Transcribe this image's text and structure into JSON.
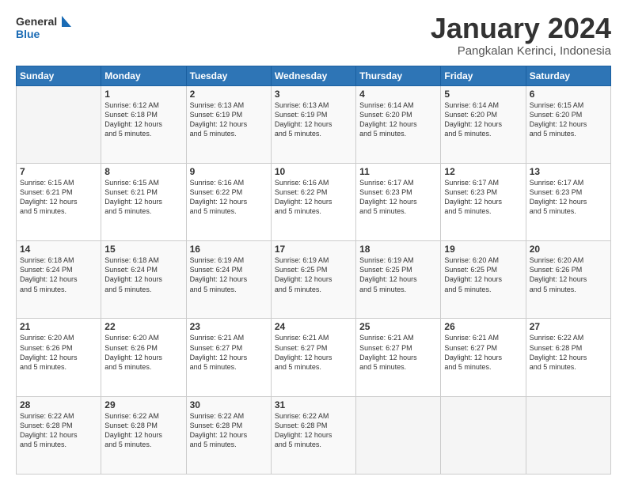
{
  "logo": {
    "line1": "General",
    "line2": "Blue"
  },
  "title": "January 2024",
  "subtitle": "Pangkalan Kerinci, Indonesia",
  "weekdays": [
    "Sunday",
    "Monday",
    "Tuesday",
    "Wednesday",
    "Thursday",
    "Friday",
    "Saturday"
  ],
  "weeks": [
    [
      {
        "day": "",
        "info": ""
      },
      {
        "day": "1",
        "info": "Sunrise: 6:12 AM\nSunset: 6:18 PM\nDaylight: 12 hours\nand 5 minutes."
      },
      {
        "day": "2",
        "info": "Sunrise: 6:13 AM\nSunset: 6:19 PM\nDaylight: 12 hours\nand 5 minutes."
      },
      {
        "day": "3",
        "info": "Sunrise: 6:13 AM\nSunset: 6:19 PM\nDaylight: 12 hours\nand 5 minutes."
      },
      {
        "day": "4",
        "info": "Sunrise: 6:14 AM\nSunset: 6:20 PM\nDaylight: 12 hours\nand 5 minutes."
      },
      {
        "day": "5",
        "info": "Sunrise: 6:14 AM\nSunset: 6:20 PM\nDaylight: 12 hours\nand 5 minutes."
      },
      {
        "day": "6",
        "info": "Sunrise: 6:15 AM\nSunset: 6:20 PM\nDaylight: 12 hours\nand 5 minutes."
      }
    ],
    [
      {
        "day": "7",
        "info": "Sunrise: 6:15 AM\nSunset: 6:21 PM\nDaylight: 12 hours\nand 5 minutes."
      },
      {
        "day": "8",
        "info": "Sunrise: 6:15 AM\nSunset: 6:21 PM\nDaylight: 12 hours\nand 5 minutes."
      },
      {
        "day": "9",
        "info": "Sunrise: 6:16 AM\nSunset: 6:22 PM\nDaylight: 12 hours\nand 5 minutes."
      },
      {
        "day": "10",
        "info": "Sunrise: 6:16 AM\nSunset: 6:22 PM\nDaylight: 12 hours\nand 5 minutes."
      },
      {
        "day": "11",
        "info": "Sunrise: 6:17 AM\nSunset: 6:23 PM\nDaylight: 12 hours\nand 5 minutes."
      },
      {
        "day": "12",
        "info": "Sunrise: 6:17 AM\nSunset: 6:23 PM\nDaylight: 12 hours\nand 5 minutes."
      },
      {
        "day": "13",
        "info": "Sunrise: 6:17 AM\nSunset: 6:23 PM\nDaylight: 12 hours\nand 5 minutes."
      }
    ],
    [
      {
        "day": "14",
        "info": "Sunrise: 6:18 AM\nSunset: 6:24 PM\nDaylight: 12 hours\nand 5 minutes."
      },
      {
        "day": "15",
        "info": "Sunrise: 6:18 AM\nSunset: 6:24 PM\nDaylight: 12 hours\nand 5 minutes."
      },
      {
        "day": "16",
        "info": "Sunrise: 6:19 AM\nSunset: 6:24 PM\nDaylight: 12 hours\nand 5 minutes."
      },
      {
        "day": "17",
        "info": "Sunrise: 6:19 AM\nSunset: 6:25 PM\nDaylight: 12 hours\nand 5 minutes."
      },
      {
        "day": "18",
        "info": "Sunrise: 6:19 AM\nSunset: 6:25 PM\nDaylight: 12 hours\nand 5 minutes."
      },
      {
        "day": "19",
        "info": "Sunrise: 6:20 AM\nSunset: 6:25 PM\nDaylight: 12 hours\nand 5 minutes."
      },
      {
        "day": "20",
        "info": "Sunrise: 6:20 AM\nSunset: 6:26 PM\nDaylight: 12 hours\nand 5 minutes."
      }
    ],
    [
      {
        "day": "21",
        "info": "Sunrise: 6:20 AM\nSunset: 6:26 PM\nDaylight: 12 hours\nand 5 minutes."
      },
      {
        "day": "22",
        "info": "Sunrise: 6:20 AM\nSunset: 6:26 PM\nDaylight: 12 hours\nand 5 minutes."
      },
      {
        "day": "23",
        "info": "Sunrise: 6:21 AM\nSunset: 6:27 PM\nDaylight: 12 hours\nand 5 minutes."
      },
      {
        "day": "24",
        "info": "Sunrise: 6:21 AM\nSunset: 6:27 PM\nDaylight: 12 hours\nand 5 minutes."
      },
      {
        "day": "25",
        "info": "Sunrise: 6:21 AM\nSunset: 6:27 PM\nDaylight: 12 hours\nand 5 minutes."
      },
      {
        "day": "26",
        "info": "Sunrise: 6:21 AM\nSunset: 6:27 PM\nDaylight: 12 hours\nand 5 minutes."
      },
      {
        "day": "27",
        "info": "Sunrise: 6:22 AM\nSunset: 6:28 PM\nDaylight: 12 hours\nand 5 minutes."
      }
    ],
    [
      {
        "day": "28",
        "info": "Sunrise: 6:22 AM\nSunset: 6:28 PM\nDaylight: 12 hours\nand 5 minutes."
      },
      {
        "day": "29",
        "info": "Sunrise: 6:22 AM\nSunset: 6:28 PM\nDaylight: 12 hours\nand 5 minutes."
      },
      {
        "day": "30",
        "info": "Sunrise: 6:22 AM\nSunset: 6:28 PM\nDaylight: 12 hours\nand 5 minutes."
      },
      {
        "day": "31",
        "info": "Sunrise: 6:22 AM\nSunset: 6:28 PM\nDaylight: 12 hours\nand 5 minutes."
      },
      {
        "day": "",
        "info": ""
      },
      {
        "day": "",
        "info": ""
      },
      {
        "day": "",
        "info": ""
      }
    ]
  ]
}
